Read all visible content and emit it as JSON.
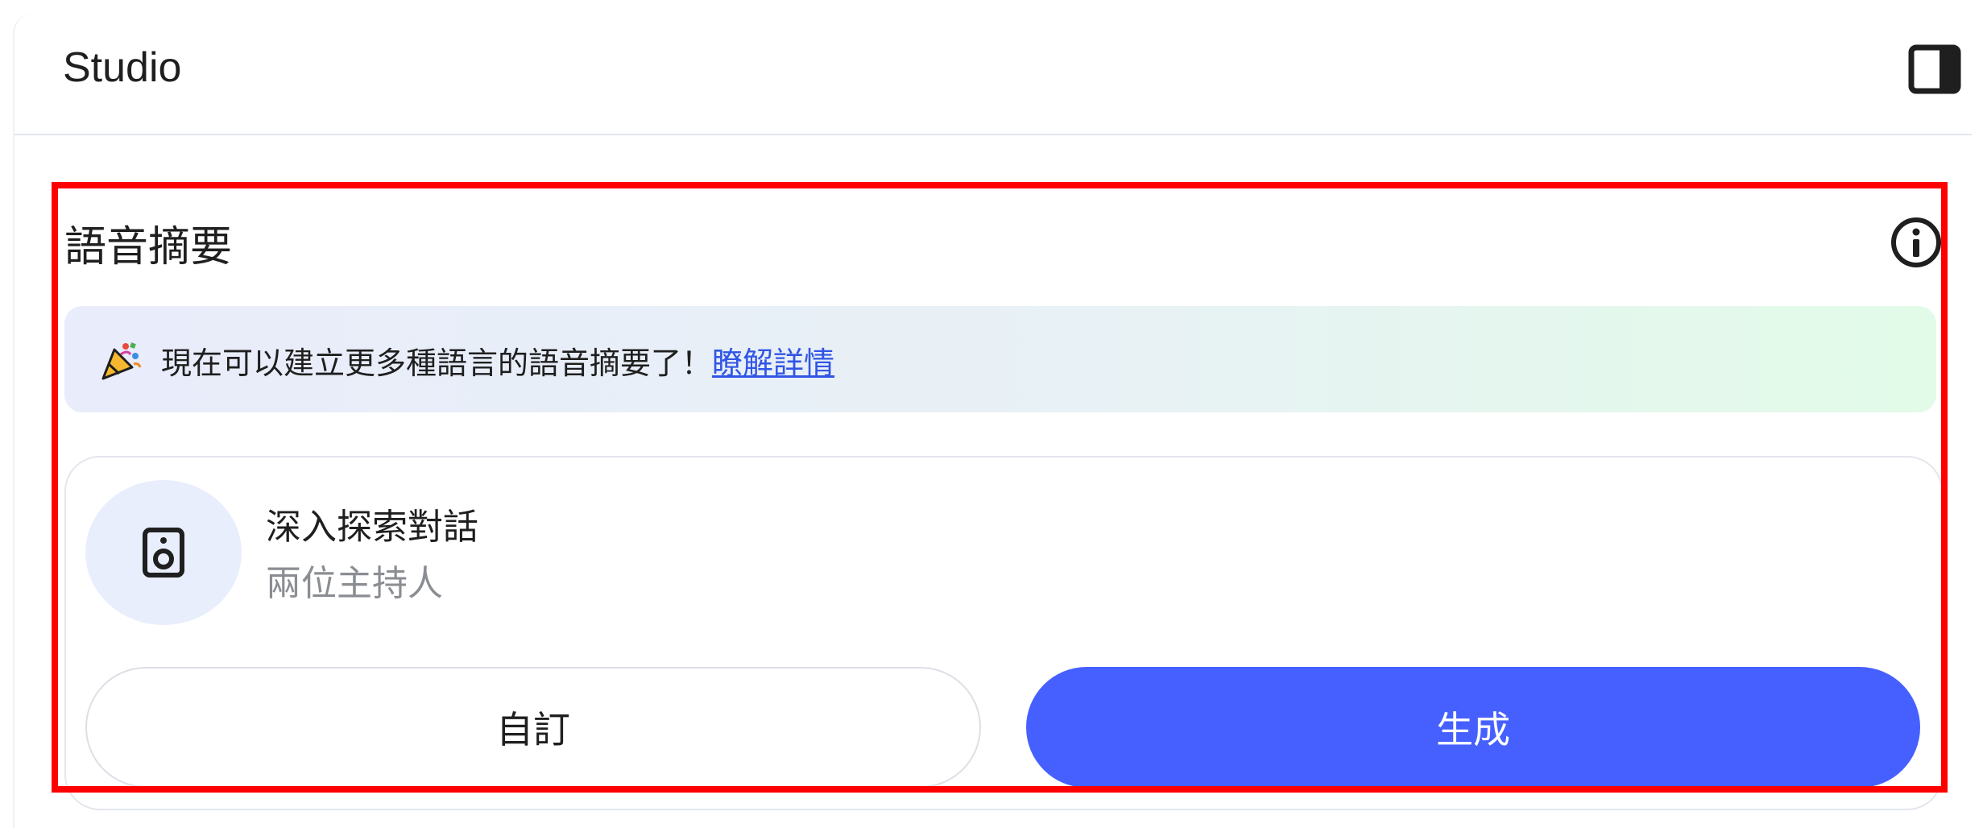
{
  "header": {
    "title": "Studio",
    "panel_toggle_icon": "dock-right-icon"
  },
  "audio_overview": {
    "title": "語音摘要",
    "info_icon": "info-icon",
    "banner": {
      "icon": "party-popper-icon",
      "text": "現在可以建立更多種語言的語音摘要了！",
      "link_text": "瞭解詳情"
    },
    "card": {
      "icon": "speaker-icon",
      "title": "深入探索對話",
      "subtitle": "兩位主持人"
    },
    "buttons": {
      "customize_label": "自訂",
      "generate_label": "生成"
    }
  },
  "colors": {
    "accent": "#4560ff",
    "link": "#3155e6",
    "highlight_border": "#ff0000"
  }
}
